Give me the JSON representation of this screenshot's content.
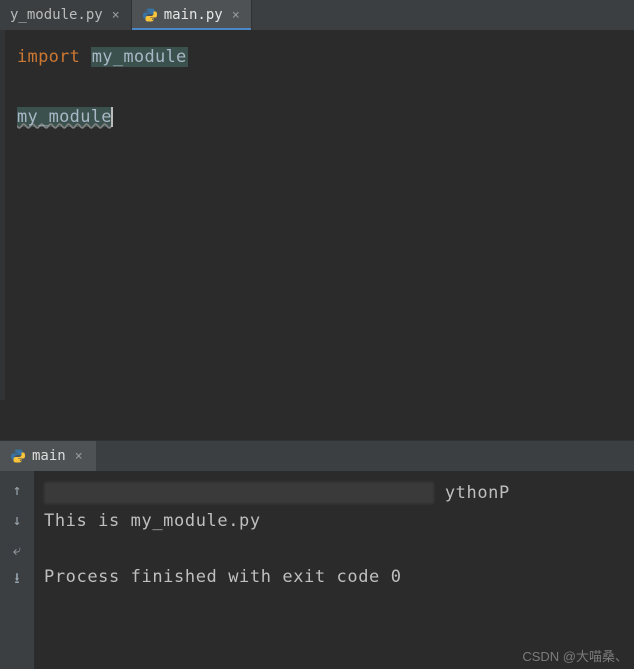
{
  "editor": {
    "tabs": [
      {
        "name": "y_module.py",
        "active": false
      },
      {
        "name": "main.py",
        "active": true
      }
    ],
    "code": {
      "line1_kw": "import",
      "line1_space": " ",
      "line1_mod": "my_module",
      "blank": "",
      "line3_expr": "my_module"
    }
  },
  "run": {
    "tab_label": "main",
    "path_tail": "ythonP",
    "out_line": "This is my_module.py",
    "blank": "",
    "exit_line": "Process finished with exit code 0"
  },
  "watermark": "CSDN @大喵桑、",
  "icons": {
    "close": "×",
    "up": "↑",
    "down": "↓",
    "wrap": "⤶",
    "export": "⭳"
  }
}
